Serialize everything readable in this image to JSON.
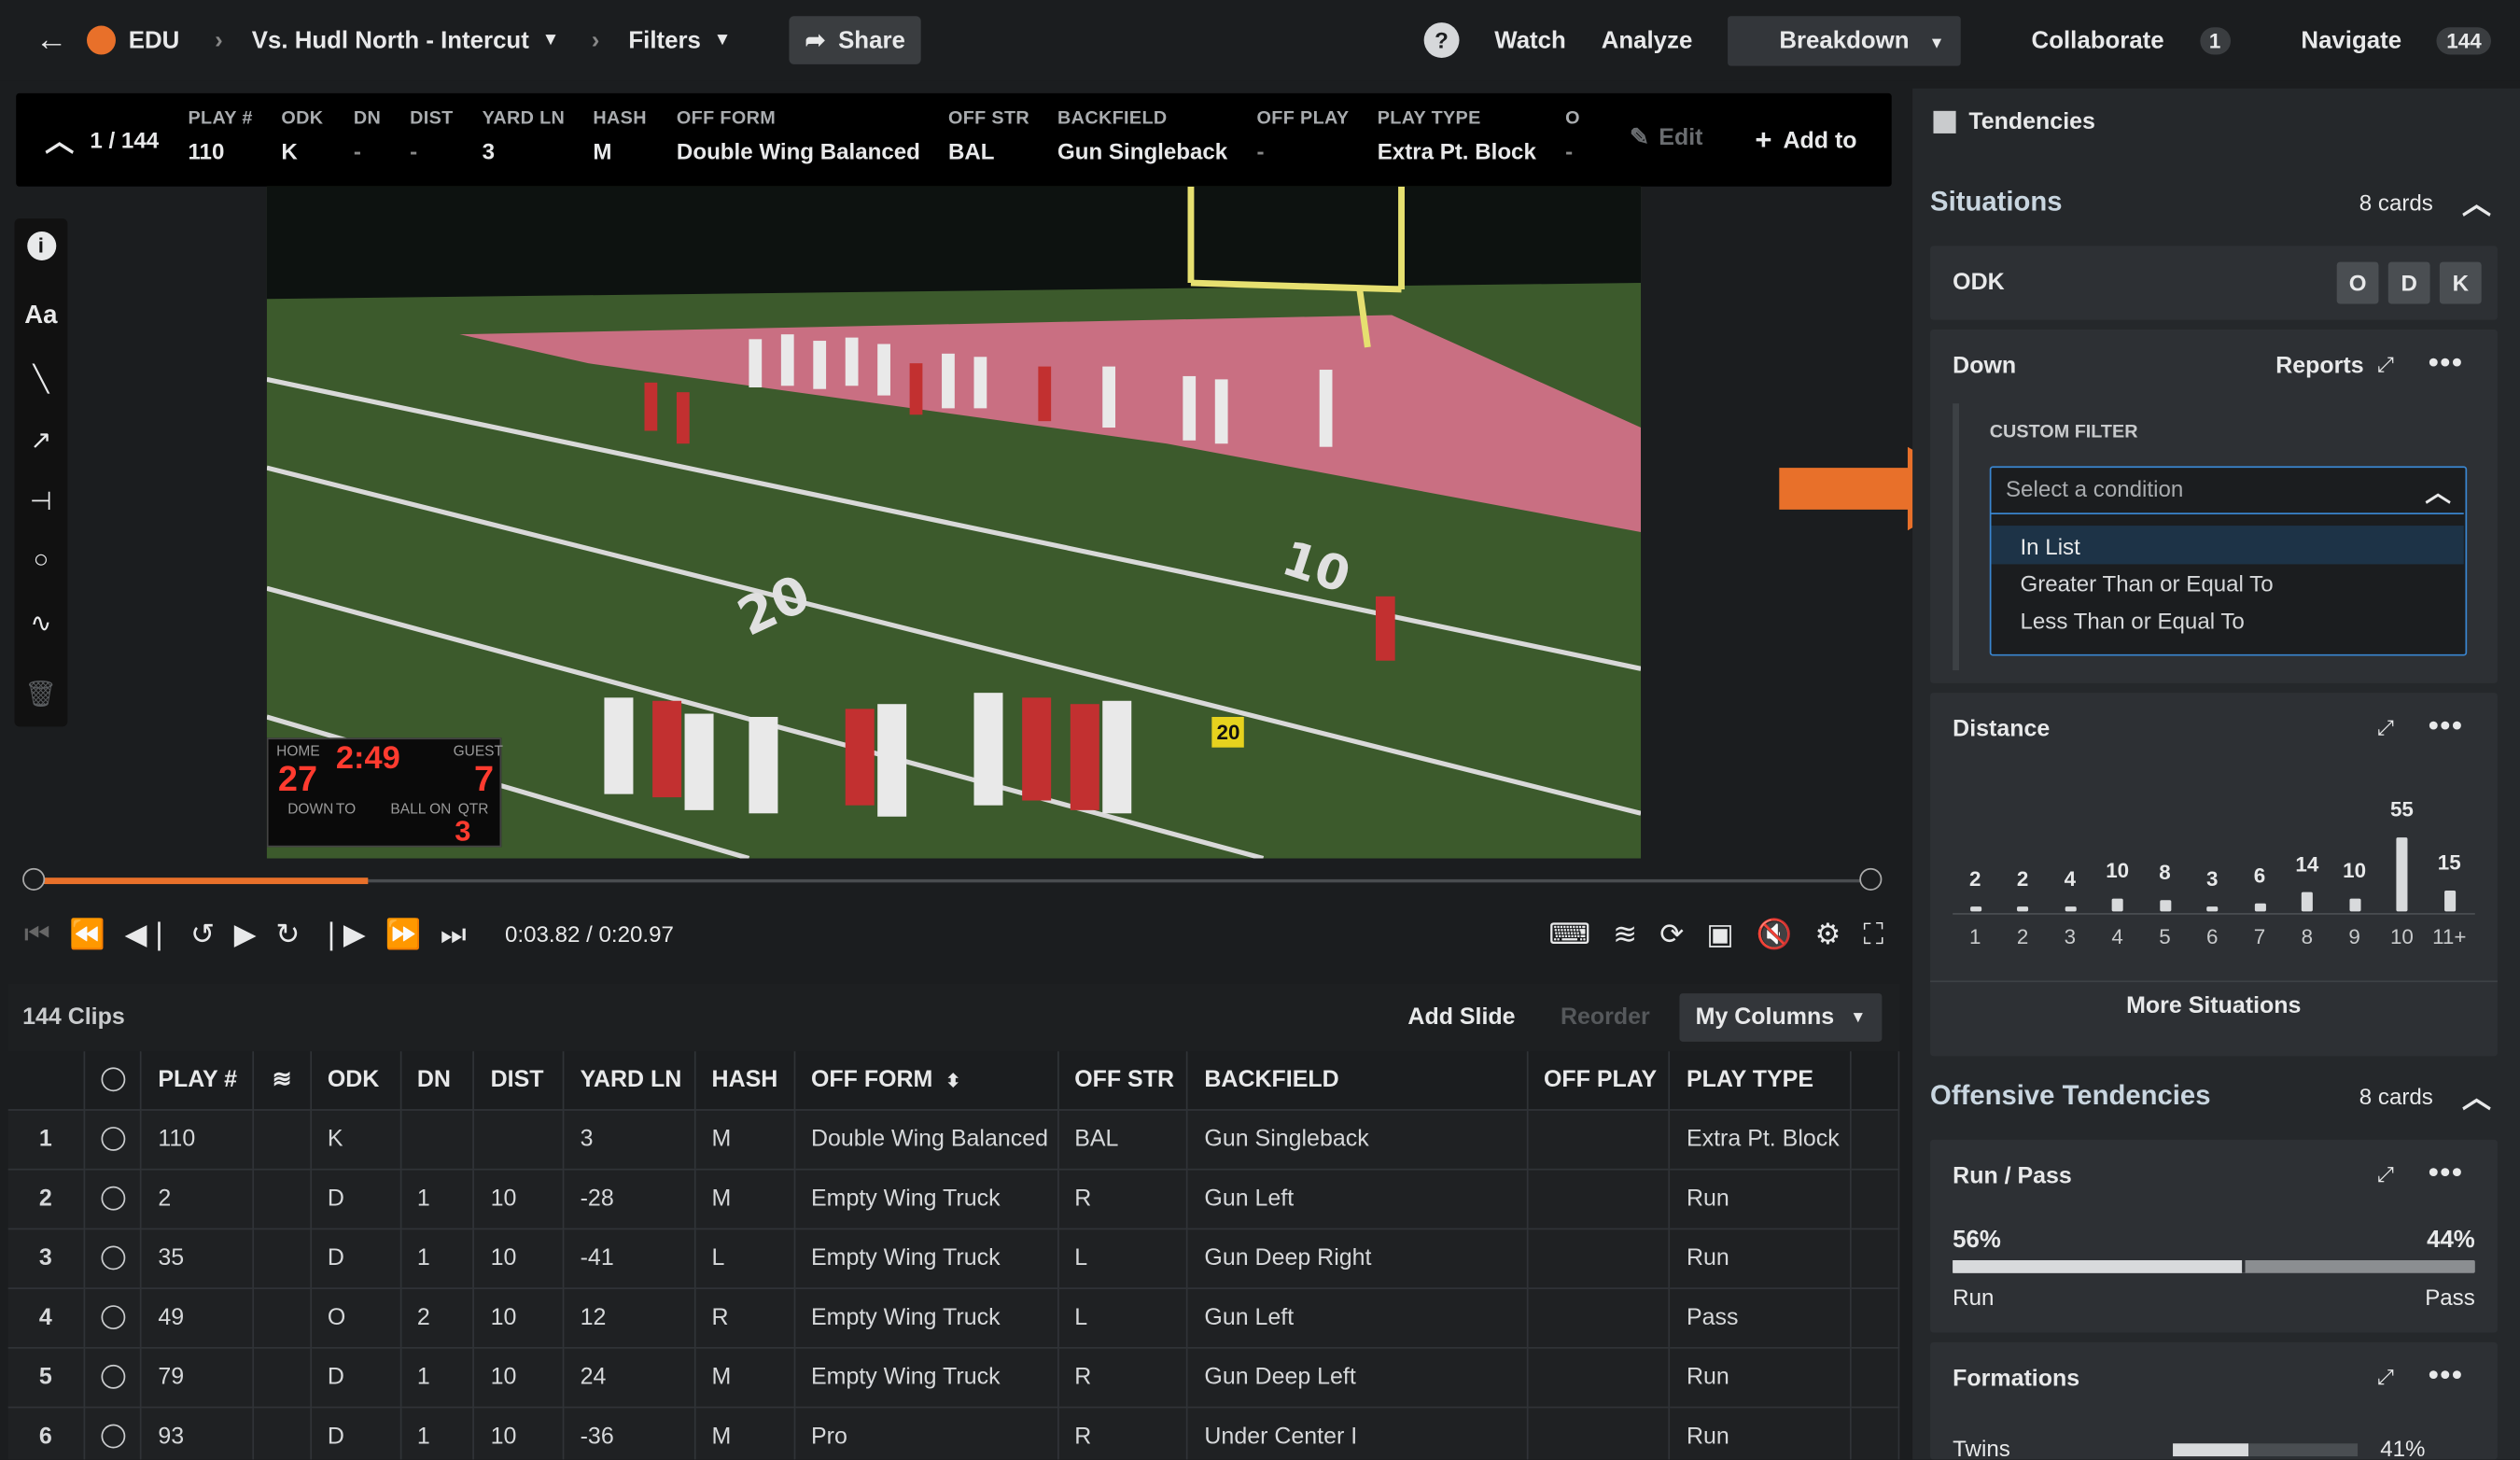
{
  "nav": {
    "brand": "EDU",
    "game": "Vs. Hudl North - Intercut",
    "filters": "Filters",
    "share": "Share",
    "help": "?",
    "watch": "Watch",
    "analyze": "Analyze",
    "breakdown": "Breakdown",
    "collaborate": "Collaborate",
    "collaborate_count": "1",
    "navigate": "Navigate",
    "navigate_count": "144"
  },
  "infobar": {
    "counter": "1 / 144",
    "fields": [
      {
        "h": "PLAY #",
        "v": "110"
      },
      {
        "h": "ODK",
        "v": "K"
      },
      {
        "h": "DN",
        "v": "-"
      },
      {
        "h": "DIST",
        "v": "-"
      },
      {
        "h": "YARD LN",
        "v": "3"
      },
      {
        "h": "HASH",
        "v": "M"
      },
      {
        "h": "OFF FORM",
        "v": "Double Wing Balanced"
      },
      {
        "h": "OFF STR",
        "v": "BAL"
      },
      {
        "h": "BACKFIELD",
        "v": "Gun Singleback"
      },
      {
        "h": "OFF PLAY",
        "v": "-"
      },
      {
        "h": "PLAY TYPE",
        "v": "Extra Pt. Block"
      },
      {
        "h": "O",
        "v": "-"
      }
    ],
    "edit": "Edit",
    "add_to": "Add to"
  },
  "scoreboard": {
    "home_label": "HOME",
    "home": "27",
    "guest_label": "GUEST",
    "guest": "7",
    "clock": "2:49",
    "down_label": "DOWN",
    "to_label": "TO",
    "ball_label": "BALL ON",
    "qtr_label": "QTR",
    "qtr": "3"
  },
  "field_marker": "20",
  "tools": {
    "text": "Aa"
  },
  "player": {
    "time": "0:03.82 / 0:20.97",
    "progress": 0.182
  },
  "clips": {
    "count": "144 Clips",
    "add_slide": "Add Slide",
    "reorder": "Reorder",
    "my_columns": "My Columns",
    "columns": [
      "PLAY #",
      "ODK",
      "DN",
      "DIST",
      "YARD LN",
      "HASH",
      "OFF FORM",
      "OFF STR",
      "BACKFIELD",
      "OFF PLAY",
      "PLAY TYPE"
    ],
    "rows": [
      {
        "n": "1",
        "play": "110",
        "odk": "K",
        "dn": "",
        "dist": "",
        "yard": "3",
        "hash": "M",
        "form": "Double Wing Balanced",
        "str": "BAL",
        "back": "Gun Singleback",
        "offplay": "",
        "type": "Extra Pt. Block"
      },
      {
        "n": "2",
        "play": "2",
        "odk": "D",
        "dn": "1",
        "dist": "10",
        "yard": "-28",
        "hash": "M",
        "form": "Empty Wing Truck",
        "str": "R",
        "back": "Gun Left",
        "offplay": "",
        "type": "Run"
      },
      {
        "n": "3",
        "play": "35",
        "odk": "D",
        "dn": "1",
        "dist": "10",
        "yard": "-41",
        "hash": "L",
        "form": "Empty Wing Truck",
        "str": "L",
        "back": "Gun Deep Right",
        "offplay": "",
        "type": "Run"
      },
      {
        "n": "4",
        "play": "49",
        "odk": "O",
        "dn": "2",
        "dist": "10",
        "yard": "12",
        "hash": "R",
        "form": "Empty Wing Truck",
        "str": "L",
        "back": "Gun Left",
        "offplay": "",
        "type": "Pass"
      },
      {
        "n": "5",
        "play": "79",
        "odk": "D",
        "dn": "1",
        "dist": "10",
        "yard": "24",
        "hash": "M",
        "form": "Empty Wing Truck",
        "str": "R",
        "back": "Gun Deep Left",
        "offplay": "",
        "type": "Run"
      },
      {
        "n": "6",
        "play": "93",
        "odk": "D",
        "dn": "1",
        "dist": "10",
        "yard": "-36",
        "hash": "M",
        "form": "Pro",
        "str": "R",
        "back": "Under Center I",
        "offplay": "",
        "type": "Run"
      }
    ]
  },
  "tendencies": {
    "title": "Tendencies",
    "situations": "Situations",
    "situations_cards": "8 cards",
    "odk_label": "ODK",
    "odk_buttons": [
      "O",
      "D",
      "K"
    ],
    "down_label": "Down",
    "reports": "Reports",
    "custom_filter": "CUSTOM FILTER",
    "condition_placeholder": "Select a condition",
    "options": [
      "In List",
      "Greater Than or Equal To",
      "Less Than or Equal To"
    ],
    "distance_label": "Distance",
    "distance_bars": [
      {
        "x": "1",
        "v": 2
      },
      {
        "x": "2",
        "v": 2
      },
      {
        "x": "3",
        "v": 4
      },
      {
        "x": "4",
        "v": 10
      },
      {
        "x": "5",
        "v": 8
      },
      {
        "x": "6",
        "v": 3
      },
      {
        "x": "7",
        "v": 6
      },
      {
        "x": "8",
        "v": 14
      },
      {
        "x": "9",
        "v": 10
      },
      {
        "x": "10",
        "v": 55
      },
      {
        "x": "11+",
        "v": 15
      }
    ],
    "more_situations": "More Situations",
    "offensive": "Offensive Tendencies",
    "offensive_cards": "8 cards",
    "runpass_label": "Run / Pass",
    "run_pct": "56%",
    "pass_pct": "44%",
    "run_frac": 0.56,
    "run_label": "Run",
    "pass_label": "Pass",
    "formations_label": "Formations",
    "twins_label": "Twins",
    "twins_pct": "41%",
    "twins_frac": 0.41
  },
  "colors": {
    "accent": "#e8702a",
    "selected": "#1d3347",
    "dropdown_border": "#3a86d0"
  }
}
